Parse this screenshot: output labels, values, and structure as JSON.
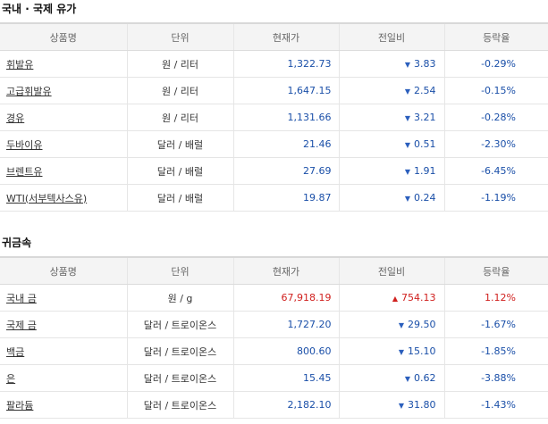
{
  "oil": {
    "title": "국내 · 국제 유가",
    "headers": [
      "상품명",
      "단위",
      "현재가",
      "전일비",
      "등락율"
    ],
    "rows": [
      {
        "name": "휘발유",
        "unit": "원 / 리터",
        "price": "1,322.73",
        "direction": "down",
        "change": "3.83",
        "rate": "-0.29%"
      },
      {
        "name": "고급휘발유",
        "unit": "원 / 리터",
        "price": "1,647.15",
        "direction": "down",
        "change": "2.54",
        "rate": "-0.15%"
      },
      {
        "name": "경유",
        "unit": "원 / 리터",
        "price": "1,131.66",
        "direction": "down",
        "change": "3.21",
        "rate": "-0.28%"
      },
      {
        "name": "두바이유",
        "unit": "달러 / 배럴",
        "price": "21.46",
        "direction": "down",
        "change": "0.51",
        "rate": "-2.30%"
      },
      {
        "name": "브렌트유",
        "unit": "달러 / 배럴",
        "price": "27.69",
        "direction": "down",
        "change": "1.91",
        "rate": "-6.45%"
      },
      {
        "name": "WTI(서부텍사스유)",
        "unit": "달러 / 배럴",
        "price": "19.87",
        "direction": "down",
        "change": "0.24",
        "rate": "-1.19%"
      }
    ]
  },
  "metal": {
    "title": "귀금속",
    "headers": [
      "상품명",
      "단위",
      "현재가",
      "전일비",
      "등락율"
    ],
    "rows": [
      {
        "name": "국내 금",
        "unit": "원 / g",
        "price": "67,918.19",
        "direction": "up",
        "change": "754.13",
        "rate": "1.12%"
      },
      {
        "name": "국제 금",
        "unit": "달러 / 트로이온스",
        "price": "1,727.20",
        "direction": "down",
        "change": "29.50",
        "rate": "-1.67%"
      },
      {
        "name": "백금",
        "unit": "달러 / 트로이온스",
        "price": "800.60",
        "direction": "down",
        "change": "15.10",
        "rate": "-1.85%"
      },
      {
        "name": "은",
        "unit": "달러 / 트로이온스",
        "price": "15.45",
        "direction": "down",
        "change": "0.62",
        "rate": "-3.88%"
      },
      {
        "name": "팔라듐",
        "unit": "달러 / 트로이온스",
        "price": "2,182.10",
        "direction": "down",
        "change": "31.80",
        "rate": "-1.43%"
      }
    ]
  },
  "colors": {
    "up": "#d0201e",
    "down": "#1a4fa8",
    "header_bg": "#f4f4f4"
  },
  "icons": {
    "up": "triangle-up-icon",
    "down": "triangle-down-icon"
  }
}
